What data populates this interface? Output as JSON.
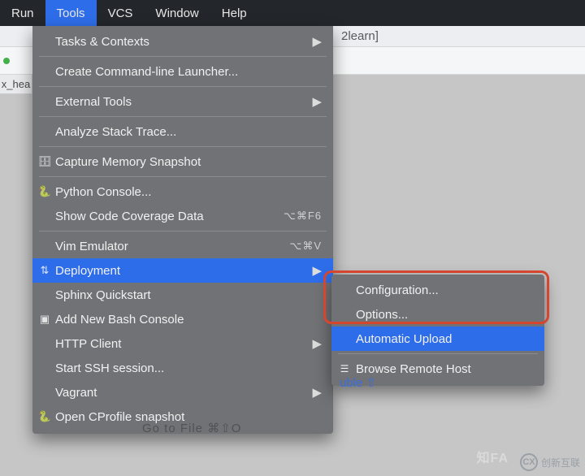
{
  "menubar": {
    "items": [
      "Run",
      "Tools",
      "VCS",
      "Window",
      "Help"
    ],
    "highlighted_index": 1
  },
  "window": {
    "title_fragment": "2learn]",
    "left_tab": "x_hea"
  },
  "tools_menu": {
    "groups": [
      [
        {
          "label": "Tasks & Contexts",
          "submenu": true
        }
      ],
      [
        {
          "label": "Create Command-line Launcher..."
        }
      ],
      [
        {
          "label": "External Tools",
          "submenu": true
        }
      ],
      [
        {
          "label": "Analyze Stack Trace..."
        }
      ],
      [
        {
          "label": "Capture Memory Snapshot",
          "icon": "memory-icon"
        }
      ],
      [
        {
          "label": "Python Console...",
          "icon": "python-icon"
        },
        {
          "label": "Show Code Coverage Data",
          "shortcut": "⌥⌘F6"
        }
      ],
      [
        {
          "label": "Vim Emulator",
          "shortcut": "⌥⌘V"
        },
        {
          "label": "Deployment",
          "icon": "deploy-icon",
          "submenu": true,
          "hover": true
        },
        {
          "label": "Sphinx Quickstart"
        },
        {
          "label": "Add New Bash Console",
          "icon": "bash-icon"
        },
        {
          "label": "HTTP Client",
          "submenu": true
        },
        {
          "label": "Start SSH session..."
        },
        {
          "label": "Vagrant",
          "submenu": true
        },
        {
          "label": "Open CProfile snapshot",
          "icon": "python-icon"
        }
      ]
    ]
  },
  "deploy_menu": {
    "groups": [
      [
        {
          "label": "Configuration..."
        },
        {
          "label": "Options..."
        },
        {
          "label": "Automatic Upload",
          "hover": true
        }
      ],
      [
        {
          "label": "Browse Remote Host",
          "icon": "remote-host-icon"
        }
      ]
    ]
  },
  "background": {
    "frag1": "uble ⇧",
    "frag2": "Go to File  ⌘⇧O"
  },
  "watermark": {
    "w1": "知FA",
    "w2": "创新互联"
  }
}
